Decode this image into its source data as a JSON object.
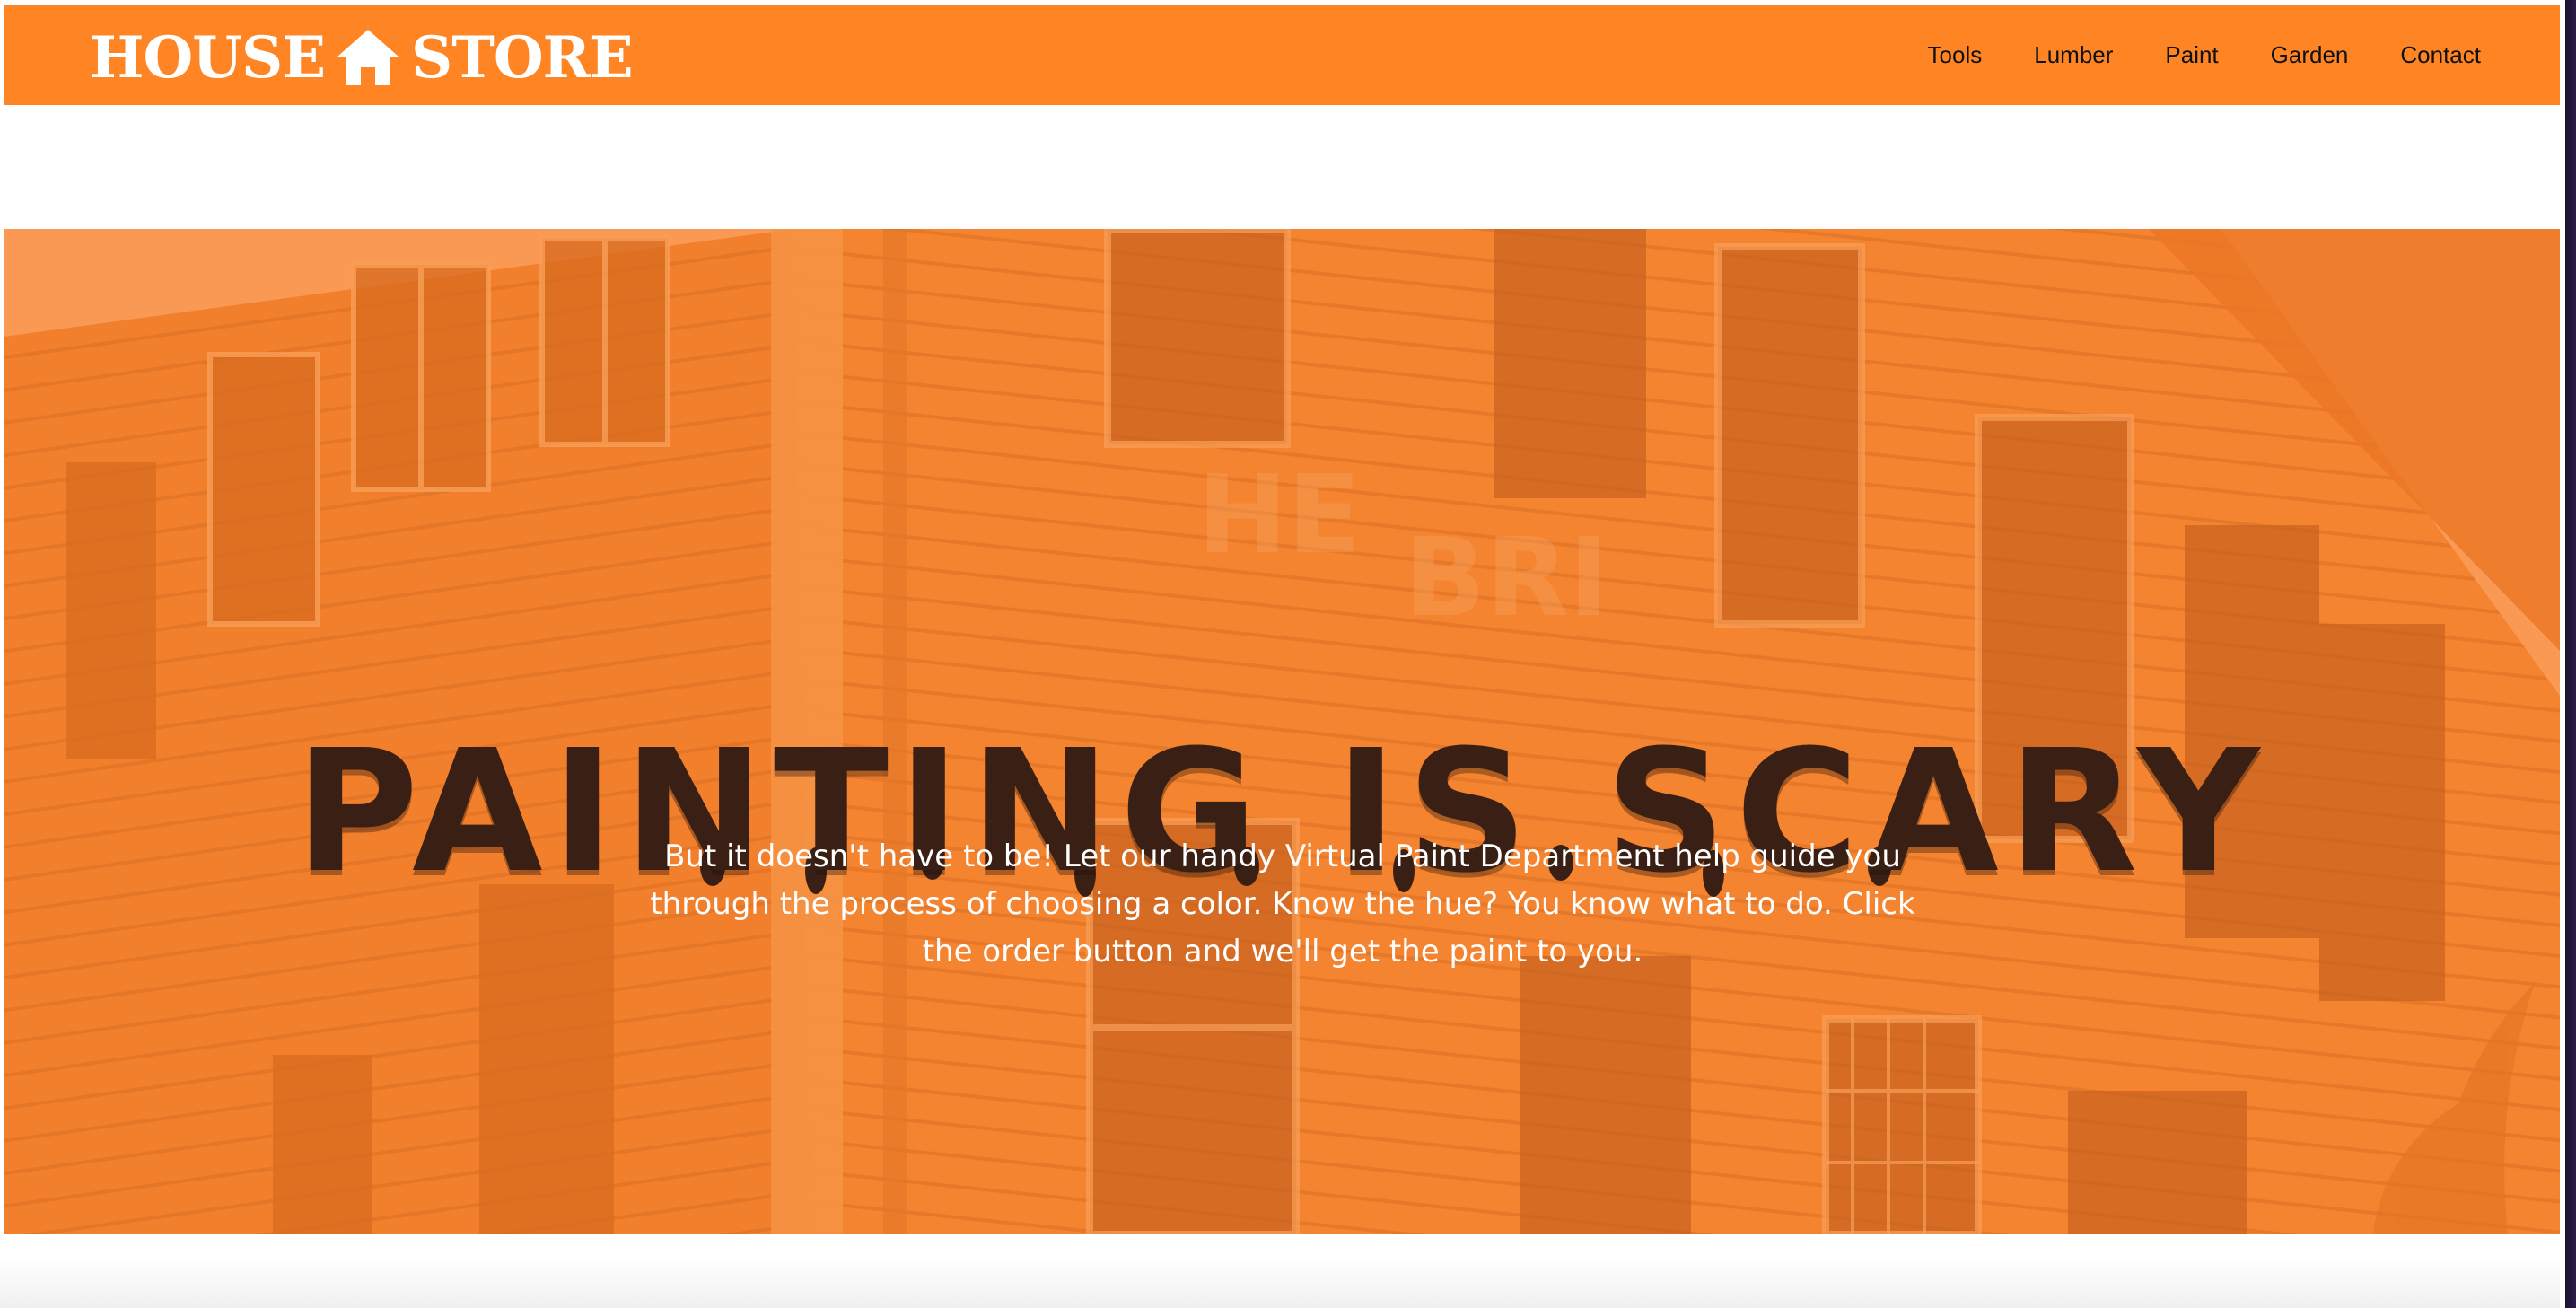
{
  "header": {
    "logo_left": "HOUSE",
    "logo_right": "STORE",
    "nav": [
      "Tools",
      "Lumber",
      "Paint",
      "Garden",
      "Contact"
    ]
  },
  "hero": {
    "title": "PAINTING IS SCARY",
    "text": "But it doesn't have to be! Let our handy Virtual Paint Department help guide you through the process of choosing a color. Know the hue? You know what to do. Click the order button and we'll get the paint to you."
  },
  "colors": {
    "brand_orange": "#ff8524",
    "hero_overlay": "#f07f2e",
    "title_brown": "#3a2014",
    "icons": [
      "house-icon"
    ]
  }
}
